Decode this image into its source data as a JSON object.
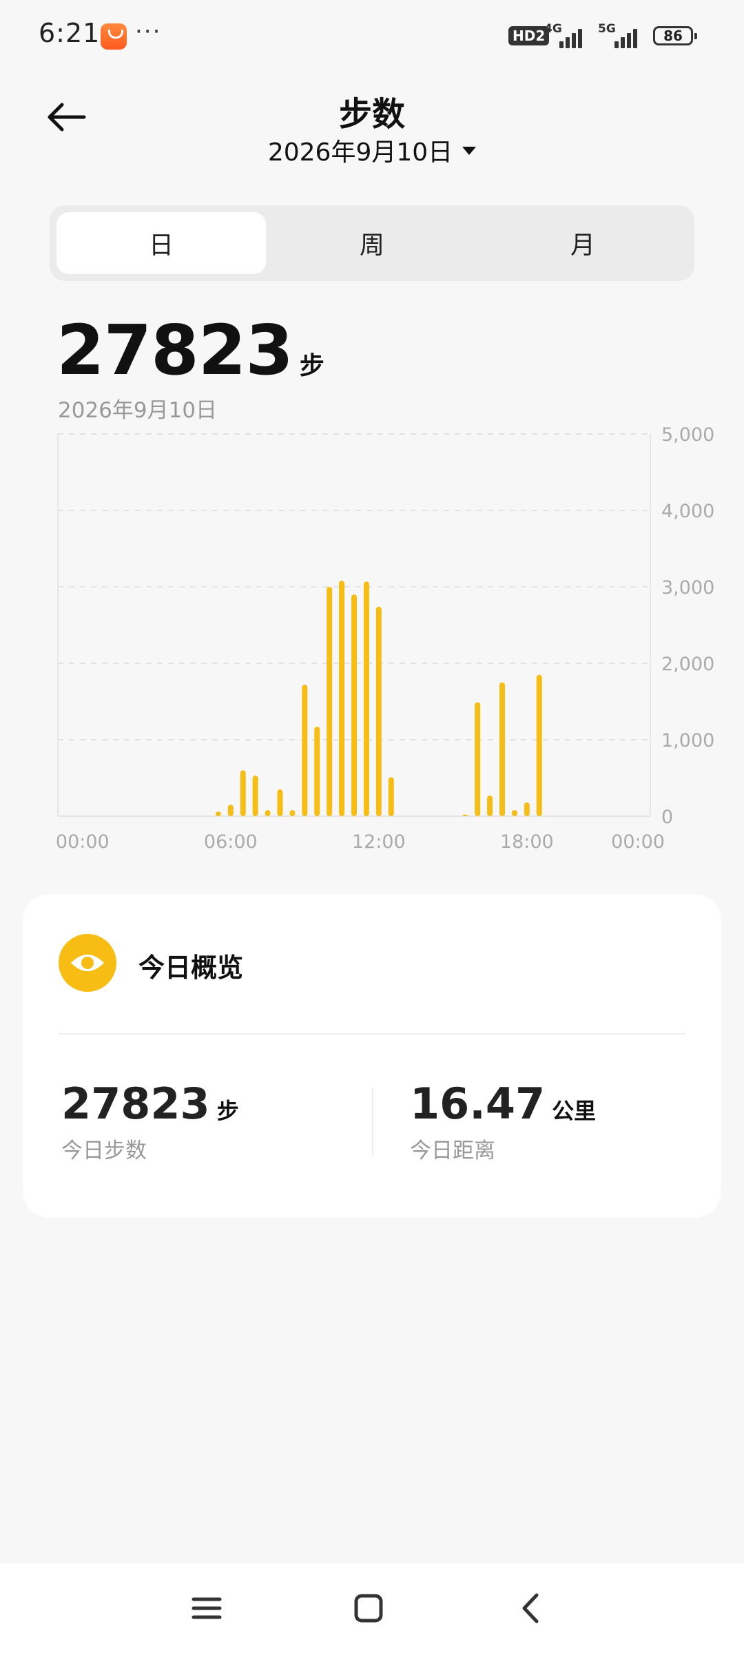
{
  "status_bar": {
    "time": "6:21",
    "more": "···",
    "hd_label": "HD2",
    "network_1": "4G",
    "network_2": "5G",
    "battery": "86"
  },
  "header": {
    "title": "步数",
    "date": "2026年9月10日"
  },
  "tabs": [
    {
      "label": "日",
      "active": true
    },
    {
      "label": "周",
      "active": false
    },
    {
      "label": "月",
      "active": false
    }
  ],
  "summary": {
    "total": "27823",
    "unit": "步",
    "date": "2026年9月10日"
  },
  "chart_data": {
    "type": "bar",
    "x_ticks": [
      "00:00",
      "06:00",
      "12:00",
      "18:00",
      "00:00"
    ],
    "y_ticks": [
      "0",
      "1,000",
      "2,000",
      "3,000",
      "4,000",
      "5,000"
    ],
    "ylim": [
      0,
      5000
    ],
    "xlim_hours": [
      0,
      24
    ],
    "bar_color": "#f6bd16",
    "grid": true,
    "x": [
      6.5,
      7.0,
      7.5,
      8.0,
      8.5,
      9.0,
      9.5,
      10.0,
      10.5,
      11.0,
      11.5,
      12.0,
      12.5,
      13.0,
      13.5,
      16.5,
      17.0,
      17.5,
      18.0,
      18.5,
      19.0,
      19.5
    ],
    "values": [
      60,
      150,
      600,
      530,
      80,
      350,
      80,
      1720,
      1170,
      3000,
      3080,
      2900,
      3070,
      2740,
      510,
      20,
      1490,
      270,
      1750,
      80,
      180,
      1850
    ]
  },
  "overview": {
    "title": "今日概览",
    "steps_value": "27823",
    "steps_unit": "步",
    "steps_label": "今日步数",
    "distance_value": "16.47",
    "distance_unit": "公里",
    "distance_label": "今日距离",
    "accent": "#f8bd14"
  },
  "nav": {
    "icons": [
      "menu-icon",
      "home-icon",
      "back-icon"
    ]
  }
}
